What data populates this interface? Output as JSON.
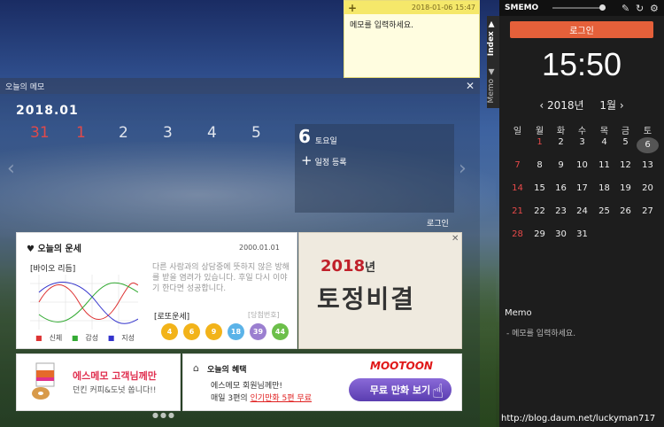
{
  "sticky": {
    "date": "2018-01-06 15:47",
    "text": "메모를 입력하세요.",
    "add": "+"
  },
  "panel": {
    "title": "오늘의 메모",
    "close": "✕",
    "month": "2018.01",
    "days": [
      {
        "n": "31",
        "red": true
      },
      {
        "n": "1",
        "red": true
      },
      {
        "n": "2"
      },
      {
        "n": "3"
      },
      {
        "n": "4"
      },
      {
        "n": "5"
      }
    ],
    "selected": {
      "num": "6",
      "dow": "토요일",
      "add": "일정 등록"
    },
    "login": "로그인"
  },
  "fortune": {
    "title": "오늘의 운세",
    "date": "2000.01.01",
    "bio": "[바이오 리듬]",
    "text": "다른 사람과의 상담중에 뜻하지 않은 방해를 받을 염려가 있습니다. 후일 다시 이야기 한다면 성공합니다.",
    "legend": [
      "신체",
      "감성",
      "지성"
    ],
    "lotto_label": "[로또운세]",
    "lotto_win": "[당첨번호]",
    "lotto": [
      {
        "n": "4",
        "c": "#f2b31a"
      },
      {
        "n": "6",
        "c": "#f2b31a"
      },
      {
        "n": "9",
        "c": "#f2b31a"
      },
      {
        "n": "18",
        "c": "#5bb3e8"
      },
      {
        "n": "39",
        "c": "#9b7fd0"
      },
      {
        "n": "44",
        "c": "#6cbf4a"
      }
    ]
  },
  "tojeong": {
    "year": "2018",
    "suffix": "년",
    "title": "토정비결",
    "close": "✕"
  },
  "ad1": {
    "l1": "에스메모 고객님께만",
    "l2": "던킨 커피&도넛 쏩니다!!"
  },
  "ad2": {
    "title": "오늘의 혜택",
    "l1": "에스메모 회원님께만!",
    "l2a": "매일 3편의 ",
    "l2b": "인기만화 5편 무료",
    "brand": "MOOTOON",
    "btn": "무료 만화 보기"
  },
  "side": {
    "app": "SMEMO",
    "login": "로그인",
    "clock": "15:50",
    "year": "2018년",
    "month": "1월",
    "dows": [
      "일",
      "월",
      "화",
      "수",
      "목",
      "금",
      "토"
    ],
    "weeks": [
      [
        "",
        "1",
        "2",
        "3",
        "4",
        "5",
        "6"
      ],
      [
        "7",
        "8",
        "9",
        "10",
        "11",
        "12",
        "13"
      ],
      [
        "14",
        "15",
        "16",
        "17",
        "18",
        "19",
        "20"
      ],
      [
        "21",
        "22",
        "23",
        "24",
        "25",
        "26",
        "27"
      ],
      [
        "28",
        "29",
        "30",
        "31",
        "",
        "",
        ""
      ]
    ],
    "memo_title": "Memo",
    "memo_text": "- 메모를 입력하세요.",
    "tab_index": "Index ▼",
    "tab_memo": "Memo ▲"
  },
  "watermark": "http://blog.daum.net/luckyman717"
}
